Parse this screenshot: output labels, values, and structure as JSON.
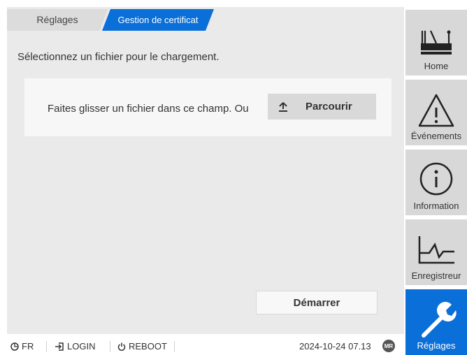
{
  "tabs": [
    {
      "label": "Réglages"
    },
    {
      "label": "Gestion de certificat"
    }
  ],
  "instruction": "Sélectionnez un fichier pour le chargement.",
  "dropzone": {
    "text": "Faites glisser un fichier dans ce champ. Ou",
    "browse_label": "Parcourir"
  },
  "start_label": "Démarrer",
  "statusbar": {
    "language": "FR",
    "login": "LOGIN",
    "reboot": "REBOOT",
    "datetime": "2024-10-24 07.13",
    "badge": "MR"
  },
  "sidebar": {
    "items": [
      {
        "label": "Home",
        "icon": "home-icon"
      },
      {
        "label": "Événements",
        "icon": "warning-icon"
      },
      {
        "label": "Information",
        "icon": "info-icon"
      },
      {
        "label": "Enregistreur",
        "icon": "recorder-icon"
      },
      {
        "label": "Réglages",
        "icon": "wrench-icon"
      }
    ]
  },
  "colors": {
    "accent": "#0a6fd8",
    "panel": "#eaeaea",
    "sidebar": "#d8d8d8"
  }
}
